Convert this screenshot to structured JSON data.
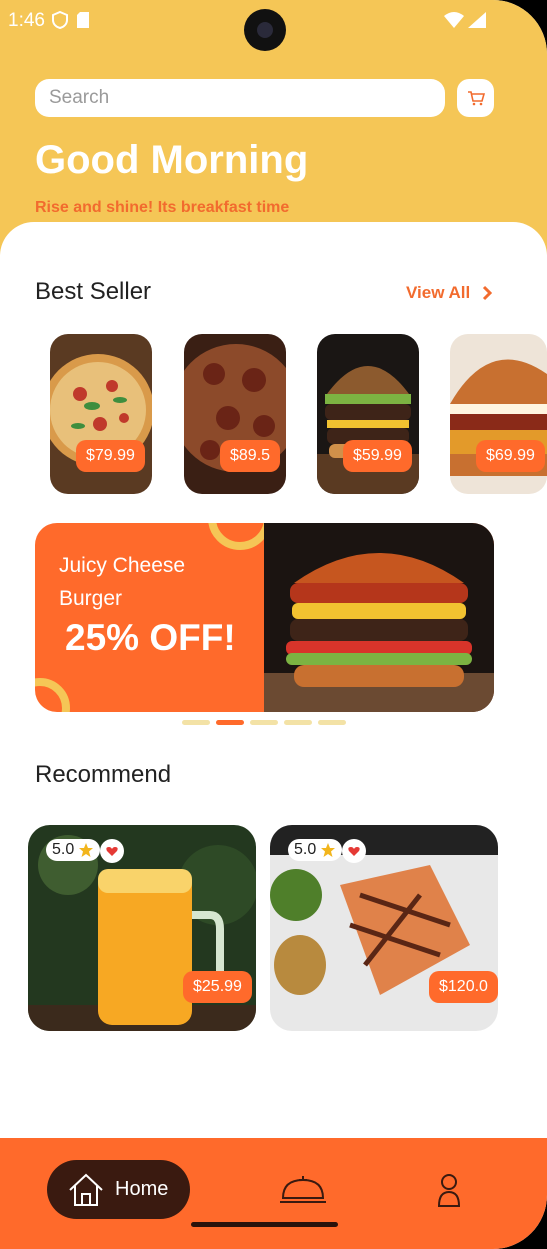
{
  "status": {
    "time": "1:46"
  },
  "search": {
    "placeholder": "Search"
  },
  "header": {
    "greeting": "Good Morning",
    "subtitle": "Rise and shine! Its breakfast time"
  },
  "best_seller": {
    "title": "Best Seller",
    "view_all": "View All",
    "items": [
      {
        "price": "$79.99",
        "image": "pizza"
      },
      {
        "price": "$89.5",
        "image": "pepperoni-pizza"
      },
      {
        "price": "$59.99",
        "image": "burger"
      },
      {
        "price": "$69.99",
        "image": "burger"
      }
    ]
  },
  "banner": {
    "title": "Juicy Cheese Burger",
    "offer": "25% OFF!",
    "page_count": 5,
    "active_index": 1
  },
  "recommend": {
    "title": "Recommend",
    "items": [
      {
        "rating": "5.0",
        "price": "$25.99",
        "image": "orange-juice"
      },
      {
        "rating": "5.0",
        "price": "$120.0",
        "image": "grilled-salmon"
      }
    ]
  },
  "nav": {
    "home_label": "Home"
  },
  "colors": {
    "header": "#F5C656",
    "accent": "#FF6A2B",
    "dark": "#3A1A10"
  }
}
